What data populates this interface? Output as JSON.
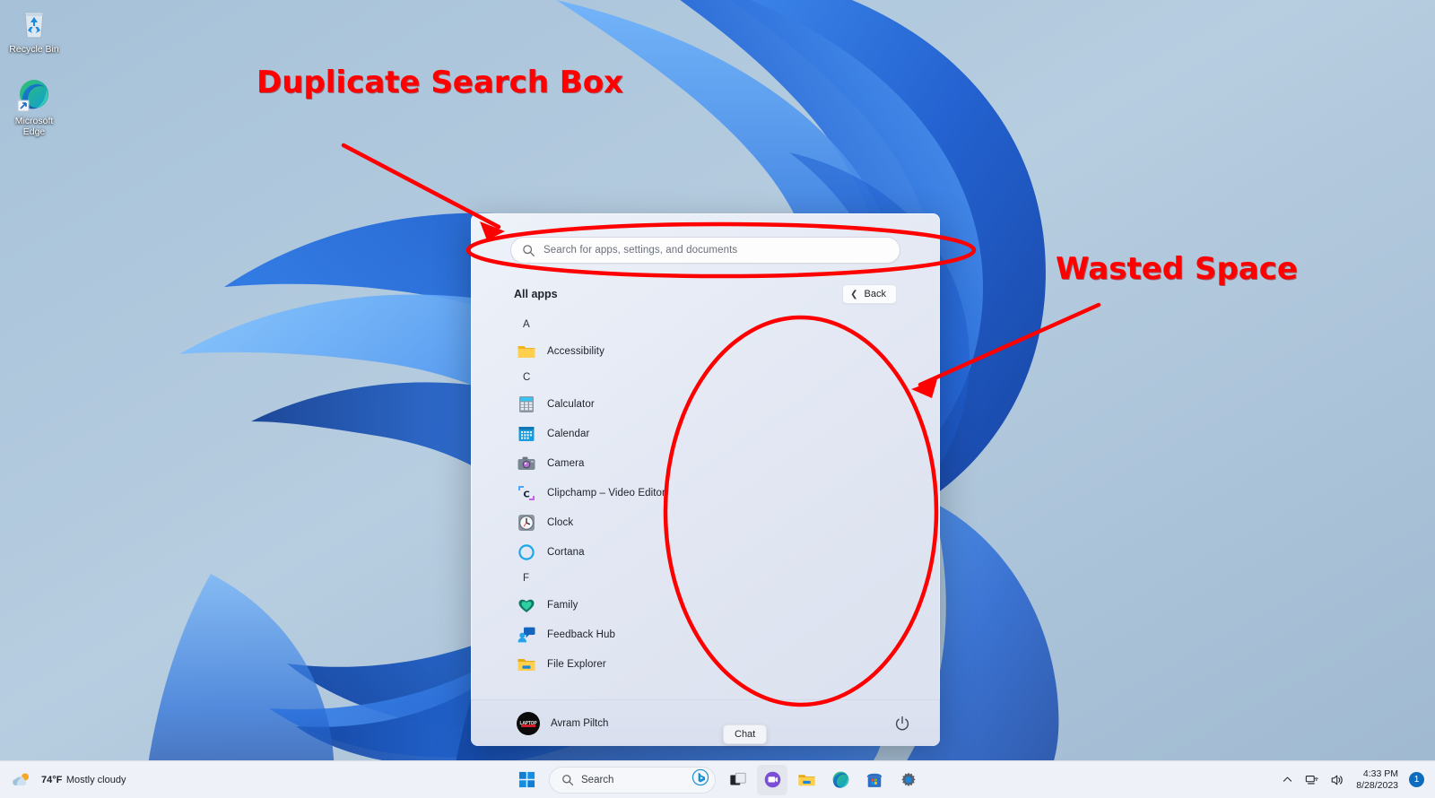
{
  "desktop": {
    "icons": [
      {
        "name": "recycle-bin",
        "label": "Recycle Bin"
      },
      {
        "name": "microsoft-edge",
        "label": "Microsoft Edge"
      }
    ]
  },
  "annotations": [
    {
      "id": "duplicate-search",
      "text": "Duplicate Search Box",
      "color": "#ff0000"
    },
    {
      "id": "wasted-space",
      "text": "Wasted Space",
      "color": "#ff0000"
    }
  ],
  "start_menu": {
    "search": {
      "placeholder": "Search for apps, settings, and documents",
      "value": "",
      "icon": "search-icon"
    },
    "header": {
      "title": "All apps",
      "back_label": "Back",
      "back_icon": "chevron-left-icon"
    },
    "sections": [
      {
        "letter": "A",
        "apps": [
          {
            "label": "Accessibility",
            "icon": "folder-icon"
          }
        ]
      },
      {
        "letter": "C",
        "apps": [
          {
            "label": "Calculator",
            "icon": "calculator-icon"
          },
          {
            "label": "Calendar",
            "icon": "calendar-icon"
          },
          {
            "label": "Camera",
            "icon": "camera-icon"
          },
          {
            "label": "Clipchamp – Video Editor",
            "icon": "clipchamp-icon"
          },
          {
            "label": "Clock",
            "icon": "clock-icon"
          },
          {
            "label": "Cortana",
            "icon": "cortana-icon"
          }
        ]
      },
      {
        "letter": "F",
        "apps": [
          {
            "label": "Family",
            "icon": "family-icon"
          },
          {
            "label": "Feedback Hub",
            "icon": "feedback-hub-icon"
          },
          {
            "label": "File Explorer",
            "icon": "file-explorer-icon"
          }
        ]
      }
    ],
    "footer": {
      "user_name": "Avram Piltch",
      "avatar_mark": "LAPTOP",
      "power_icon": "power-icon"
    }
  },
  "tooltip": {
    "text": "Chat"
  },
  "taskbar": {
    "weather": {
      "temperature": "74°F",
      "condition": "Mostly cloudy",
      "icon": "partly-cloudy-icon"
    },
    "start_button": {
      "name": "start-button",
      "icon": "windows-logo-icon"
    },
    "search": {
      "label": "Search",
      "placeholder": "Search",
      "icon": "search-icon",
      "bing_icon": "bing-chat-icon"
    },
    "pinned": [
      {
        "name": "task-view",
        "icon": "task-view-icon",
        "label": "Task view"
      },
      {
        "name": "chat",
        "icon": "chat-icon",
        "label": "Chat"
      },
      {
        "name": "file-explorer",
        "icon": "file-explorer-icon",
        "label": "File Explorer"
      },
      {
        "name": "microsoft-edge",
        "icon": "edge-icon",
        "label": "Microsoft Edge"
      },
      {
        "name": "microsoft-store",
        "icon": "store-icon",
        "label": "Microsoft Store"
      },
      {
        "name": "settings",
        "icon": "settings-icon",
        "label": "Settings"
      }
    ],
    "tray": {
      "overflow_icon": "chevron-up-icon",
      "network_icon": "network-icon",
      "volume_icon": "volume-icon",
      "time": "4:33 PM",
      "date": "8/28/2023",
      "notification_count": "1"
    }
  },
  "colors": {
    "annotation": "#ff0000",
    "accent": "#0f6cbd",
    "desktop_bg": "#b2c9db",
    "start_menu_bg": "#e4e9f4"
  }
}
